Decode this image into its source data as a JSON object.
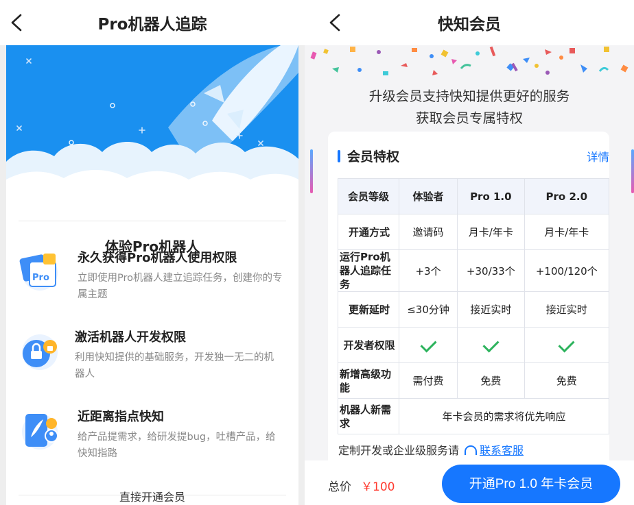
{
  "left": {
    "title": "Pro机器人追踪",
    "card_title": "体验Pro机器人",
    "features": [
      {
        "title": "永久获得Pro机器人使用权限",
        "desc": "立即使用Pro机器人建立追踪任务，创建你的专属主题",
        "icon": "pro-document-icon"
      },
      {
        "title": "激活机器人开发权限",
        "desc": "利用快知提供的基础服务，开发独一无二的机器人",
        "icon": "lock-thumb-icon"
      },
      {
        "title": "近距离指点快知",
        "desc": "给产品提需求，给研发提bug，吐槽产品，给快知指路",
        "icon": "phone-feather-icon"
      }
    ],
    "icon_badge": "Pro",
    "bottom_link": "直接开通会员"
  },
  "right": {
    "title": "快知会员",
    "subtitle_1": "升级会员支持快知提供更好的服务",
    "subtitle_2": "获取会员专属特权",
    "section_title": "会员特权",
    "detail_link": "详情",
    "table": {
      "header": [
        "会员等级",
        "体验者",
        "Pro 1.0",
        "Pro 2.0"
      ],
      "rows": [
        {
          "label": "开通方式",
          "cells": [
            "邀请码",
            "月卡/年卡",
            "月卡/年卡"
          ]
        },
        {
          "label": "运行Pro机器人追踪任务",
          "cells": [
            "+3个",
            "+30/33个",
            "+100/120个"
          ]
        },
        {
          "label": "更新延时",
          "cells": [
            "≤30分钟",
            "接近实时",
            "接近实时"
          ]
        },
        {
          "label": "开发者权限",
          "cells": [
            "check",
            "check",
            "check"
          ]
        },
        {
          "label": "新增高级功能",
          "cells": [
            "需付费",
            "免费",
            "免费"
          ]
        },
        {
          "label": "机器人新需求",
          "merged": "年卡会员的需求将优先响应"
        }
      ]
    },
    "custom_text": "定制开发或企业级服务请",
    "contact_link": "联系客服",
    "total_label": "总价",
    "total_price": "￥100",
    "buy_button": "开通Pro 1.0 年卡会员"
  },
  "colors": {
    "accent": "#1677ff",
    "price": "#ff3b30",
    "check": "#2db35d",
    "hero_sky": "#1a90f0"
  }
}
